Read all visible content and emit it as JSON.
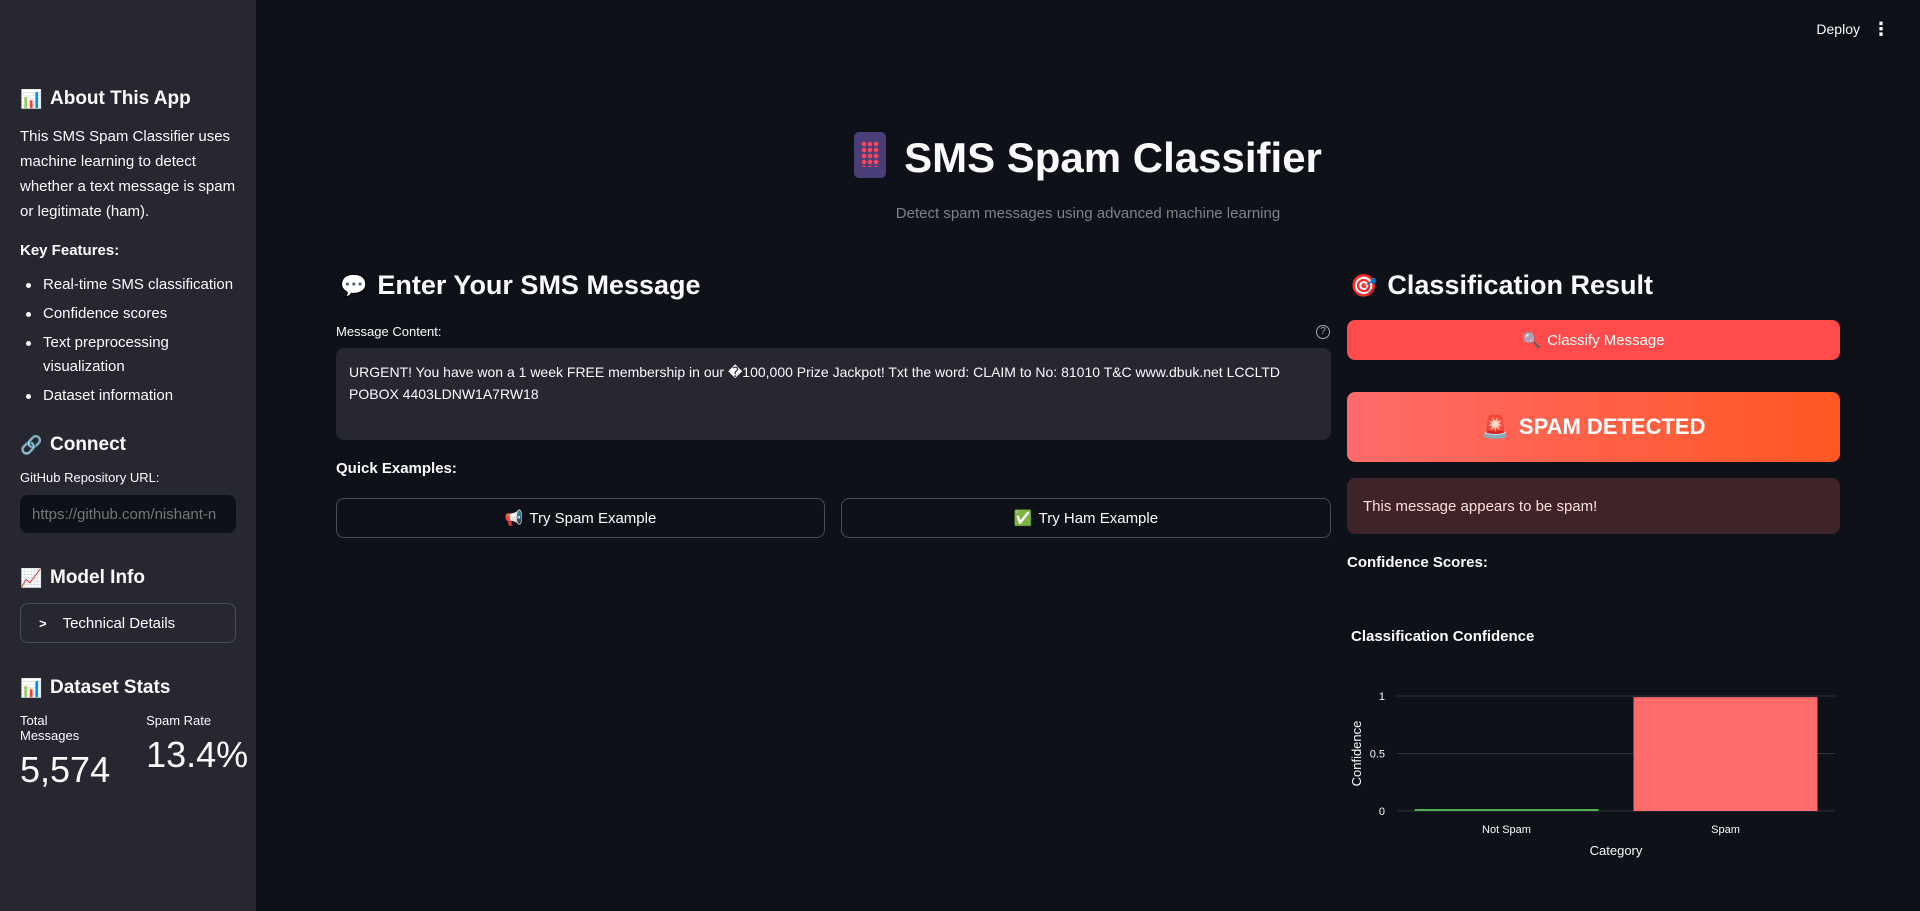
{
  "topbar": {
    "deploy_label": "Deploy",
    "menu_glyph": "⋮"
  },
  "sidebar": {
    "about": {
      "icon": "📊",
      "heading": "About This App",
      "description": "This SMS Spam Classifier uses machine learning to detect whether a text message is spam or legitimate (ham).",
      "features_heading": "Key Features:",
      "features": [
        "Real-time SMS classification",
        "Confidence scores",
        "Text preprocessing visualization",
        "Dataset information"
      ]
    },
    "connect": {
      "icon": "🔗",
      "heading": "Connect",
      "repo_label": "GitHub Repository URL:",
      "repo_placeholder": "https://github.com/nishant-n"
    },
    "model": {
      "icon": "📈",
      "heading": "Model Info",
      "expander_label": "Technical Details"
    },
    "dataset": {
      "icon": "📊",
      "heading": "Dataset Stats",
      "total_label": "Total Messages",
      "total_value": "5,574",
      "spam_rate_label": "Spam Rate",
      "spam_rate_value": "13.4%"
    }
  },
  "main": {
    "title": "SMS Spam Classifier",
    "subtitle": "Detect spam messages using advanced machine learning",
    "input_section": {
      "icon": "💬",
      "heading": "Enter Your SMS Message",
      "field_label": "Message Content:",
      "help_glyph": "?",
      "message_value": "URGENT! You have won a 1 week FREE membership in our �100,000 Prize Jackpot! Txt the word: CLAIM to No: 81010 T&C www.dbuk.net LCCLTD POBOX 4403LDNW1A7RW18",
      "quick_heading": "Quick Examples:",
      "spam_example_icon": "📢",
      "spam_example_label": "Try Spam Example",
      "ham_example_icon": "✅",
      "ham_example_label": "Try Ham Example"
    },
    "result_section": {
      "icon": "🎯",
      "heading": "Classification Result",
      "classify_icon": "🔍",
      "classify_label": "Classify Message",
      "verdict_icon": "🚨",
      "verdict_label": "SPAM DETECTED",
      "alert_text": "This message appears to be spam!",
      "confidence_heading": "Confidence Scores:"
    }
  },
  "colors": {
    "accent": "#ff4b4b",
    "spam_bar": "#ff6b6b",
    "ham_bar": "#4caf50"
  },
  "chart_data": {
    "type": "bar",
    "title": "Classification Confidence",
    "categories": [
      "Not Spam",
      "Spam"
    ],
    "values": [
      0.0,
      0.99
    ],
    "xlabel": "Category",
    "ylabel": "Confidence",
    "ylim": [
      0,
      1
    ],
    "yticks": [
      "0",
      "0.5",
      "1"
    ],
    "grid": true
  }
}
